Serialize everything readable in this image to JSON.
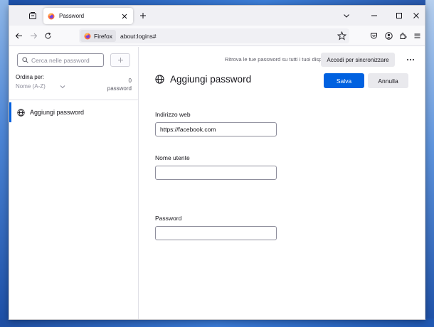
{
  "browser": {
    "tab_title": "Password",
    "identity_label": "Firefox",
    "url": "about:logins#"
  },
  "sidebar": {
    "search_placeholder": "Cerca nelle password",
    "sort_label": "Ordina per:",
    "sort_value": "Nome (A-Z)",
    "count_number": "0",
    "count_unit": "password",
    "items": [
      {
        "label": "Aggiungi password"
      }
    ]
  },
  "main": {
    "sync_message": "Ritrova le tue password su tutti i tuoi dispositivi",
    "sync_button": "Accedi per sincronizzare",
    "title": "Aggiungi password",
    "save_label": "Salva",
    "cancel_label": "Annulla",
    "fields": [
      {
        "label": "Indirizzo web",
        "value": "https://facebook.com"
      },
      {
        "label": "Nome utente",
        "value": ""
      },
      {
        "label": "Password",
        "value": ""
      }
    ]
  },
  "colors": {
    "accent": "#0061e0",
    "selected_border": "#0061e0",
    "firefox_orange": "#ff7139"
  }
}
